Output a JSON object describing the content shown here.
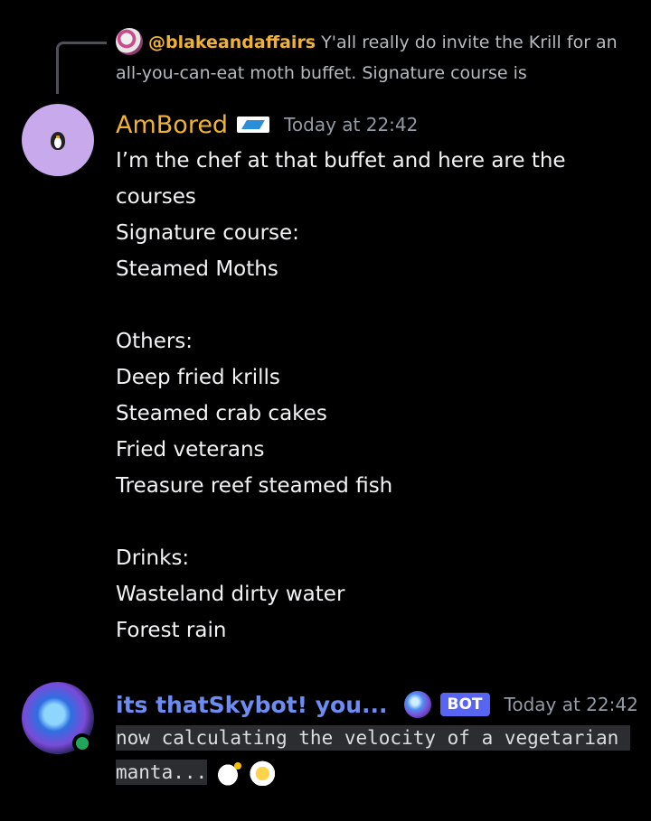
{
  "reply": {
    "author": "@blakeandaffairs",
    "text": "Y'all really do invite the Krill for an all-you-can-eat moth buffet. Signature course is"
  },
  "message1": {
    "author": "AmBored",
    "timestamp": "Today at 22:42",
    "lines": [
      "I’m the chef at that buffet and here are the",
      "courses",
      "Signature course:",
      "Steamed Moths",
      "",
      "Others:",
      "Deep fried krills",
      "Steamed crab cakes",
      "Fried veterans",
      "Treasure reef steamed fish",
      "",
      "Drinks:",
      "Wasteland dirty water",
      "Forest rain"
    ]
  },
  "message2": {
    "author": "its thatSkybot! you...",
    "tag": "BOT",
    "timestamp": "Today at 22:42",
    "text": "now calculating the velocity of a vegetarian manta..."
  },
  "colors": {
    "background": "#000000",
    "author_gold": "#f0b232",
    "bot_author": "#6d8cf2",
    "bot_tag": "#5865f2",
    "timestamp": "#949ba4",
    "online": "#23a55a"
  },
  "icons": {
    "reply_avatar": "user-avatar-icon",
    "avatar1": "penguin-avatar-icon",
    "badge1": "flag-badge-icon",
    "avatar2": "orb-avatar-icon",
    "badge2": "orb-icon",
    "emoji1": "manta-emoji-icon",
    "emoji2": "sparkle-emoji-icon"
  }
}
